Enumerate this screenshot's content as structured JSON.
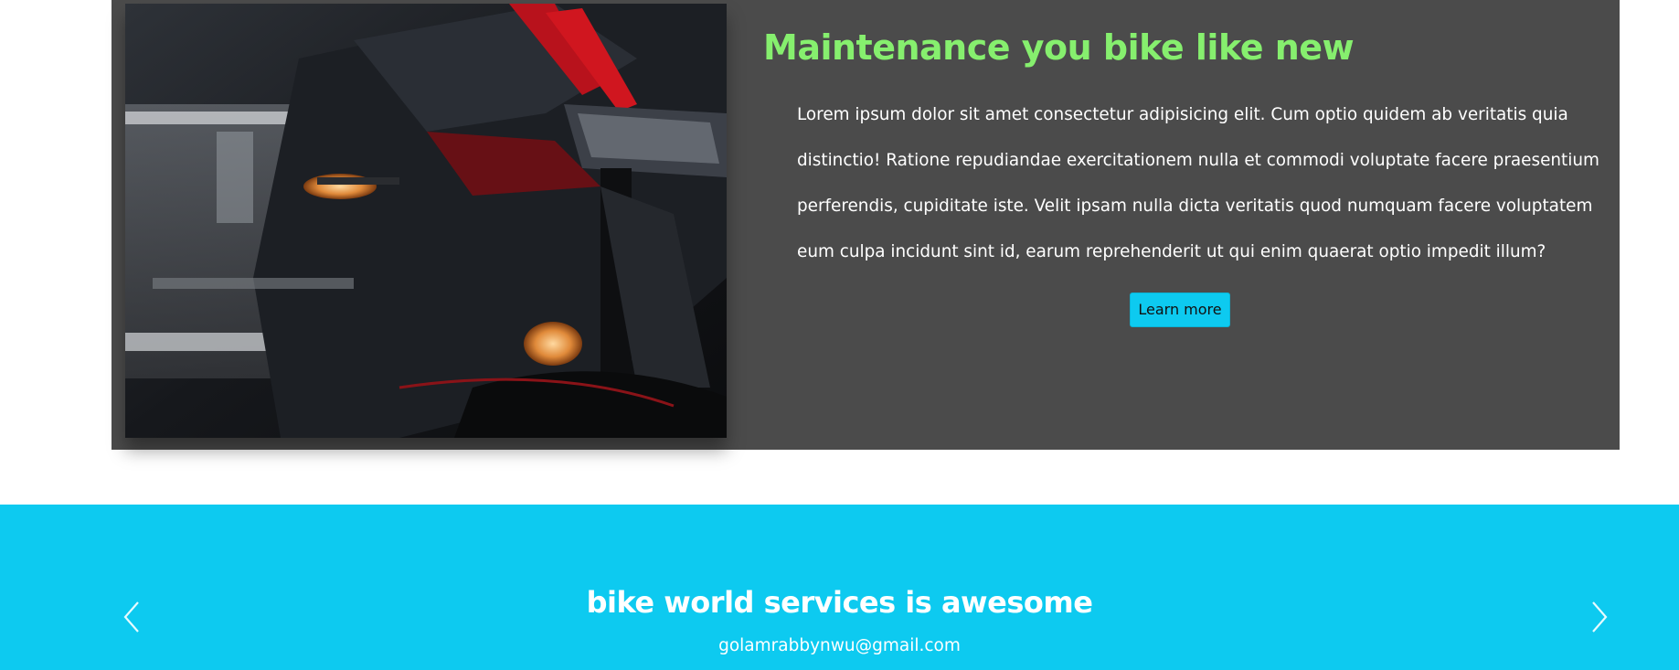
{
  "feature": {
    "image_alt": "black sport motorcycle close-up",
    "title": "Maintenance you bike like new",
    "description": "Lorem ipsum dolor sit amet consectetur adipisicing elit. Cum optio quidem ab veritatis quia distinctio! Ratione repudiandae exercitationem nulla et commodi voluptate facere praesentium perferendis, cupiditate iste. Velit ipsam nulla dicta veritatis quod numquam facere voluptatem eum culpa incidunt sint id, earum reprehenderit ut qui enim quaerat optio impedit illum?",
    "button_label": "Learn more"
  },
  "testimonial": {
    "title": "bike world services is awesome",
    "email": "golamrabbynwu@gmail.com",
    "prev_icon": "chevron-left-icon",
    "next_icon": "chevron-right-icon"
  },
  "colors": {
    "feature_bg": "#4b4b4b",
    "title_green": "#86ef6e",
    "accent_cyan": "#0dcaf0"
  }
}
